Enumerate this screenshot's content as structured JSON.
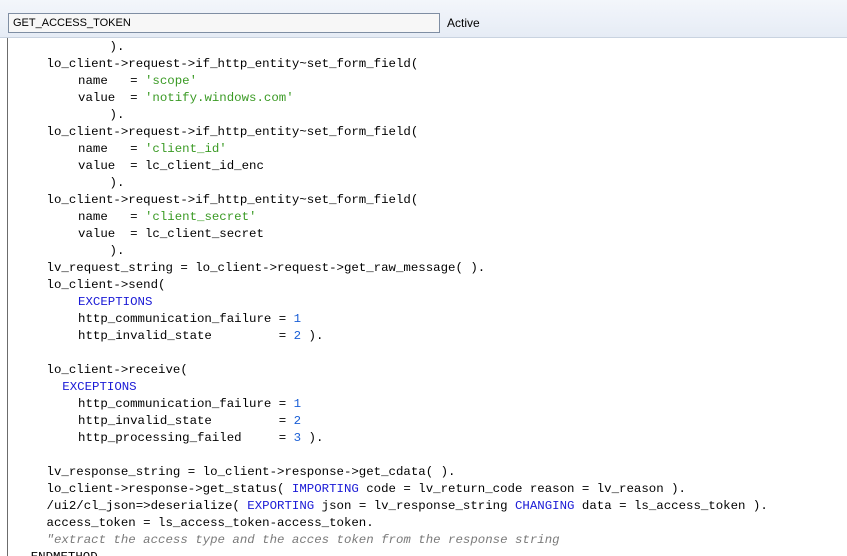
{
  "header": {
    "method_name": "GET_ACCESS_TOKEN",
    "status": "Active"
  },
  "editor": {
    "lines": [
      {
        "indent": 12,
        "tokens": [
          {
            "t": "default",
            "v": ")."
          }
        ]
      },
      {
        "indent": 4,
        "tokens": [
          {
            "t": "default",
            "v": "lo_client->request->if_http_entity~set_form_field("
          }
        ]
      },
      {
        "indent": 8,
        "tokens": [
          {
            "t": "default",
            "v": "name   = "
          },
          {
            "t": "str",
            "v": "'scope'"
          }
        ]
      },
      {
        "indent": 8,
        "tokens": [
          {
            "t": "default",
            "v": "value  = "
          },
          {
            "t": "str",
            "v": "'notify.windows.com'"
          }
        ]
      },
      {
        "indent": 12,
        "tokens": [
          {
            "t": "default",
            "v": ")."
          }
        ]
      },
      {
        "indent": 4,
        "tokens": [
          {
            "t": "default",
            "v": "lo_client->request->if_http_entity~set_form_field("
          }
        ]
      },
      {
        "indent": 8,
        "tokens": [
          {
            "t": "default",
            "v": "name   = "
          },
          {
            "t": "str",
            "v": "'client_id'"
          }
        ]
      },
      {
        "indent": 8,
        "tokens": [
          {
            "t": "default",
            "v": "value  = lc_client_id_enc"
          }
        ]
      },
      {
        "indent": 12,
        "tokens": [
          {
            "t": "default",
            "v": ")."
          }
        ]
      },
      {
        "indent": 4,
        "tokens": [
          {
            "t": "default",
            "v": "lo_client->request->if_http_entity~set_form_field("
          }
        ]
      },
      {
        "indent": 8,
        "tokens": [
          {
            "t": "default",
            "v": "name   = "
          },
          {
            "t": "str",
            "v": "'client_secret'"
          }
        ]
      },
      {
        "indent": 8,
        "tokens": [
          {
            "t": "default",
            "v": "value  = lc_client_secret"
          }
        ]
      },
      {
        "indent": 12,
        "tokens": [
          {
            "t": "default",
            "v": ")."
          }
        ]
      },
      {
        "indent": 4,
        "tokens": [
          {
            "t": "default",
            "v": "lv_request_string = lo_client->request->get_raw_message( )."
          }
        ]
      },
      {
        "indent": 4,
        "tokens": [
          {
            "t": "default",
            "v": "lo_client->send("
          }
        ]
      },
      {
        "indent": 8,
        "tokens": [
          {
            "t": "kw",
            "v": "EXCEPTIONS"
          }
        ]
      },
      {
        "indent": 8,
        "tokens": [
          {
            "t": "default",
            "v": "http_communication_failure = "
          },
          {
            "t": "num",
            "v": "1"
          }
        ]
      },
      {
        "indent": 8,
        "tokens": [
          {
            "t": "default",
            "v": "http_invalid_state         = "
          },
          {
            "t": "num",
            "v": "2"
          },
          {
            "t": "default",
            "v": " )."
          }
        ]
      },
      {
        "indent": 0,
        "tokens": []
      },
      {
        "indent": 4,
        "tokens": [
          {
            "t": "default",
            "v": "lo_client->receive("
          }
        ]
      },
      {
        "indent": 6,
        "tokens": [
          {
            "t": "kw",
            "v": "EXCEPTIONS"
          }
        ]
      },
      {
        "indent": 8,
        "tokens": [
          {
            "t": "default",
            "v": "http_communication_failure = "
          },
          {
            "t": "num",
            "v": "1"
          }
        ]
      },
      {
        "indent": 8,
        "tokens": [
          {
            "t": "default",
            "v": "http_invalid_state         = "
          },
          {
            "t": "num",
            "v": "2"
          }
        ]
      },
      {
        "indent": 8,
        "tokens": [
          {
            "t": "default",
            "v": "http_processing_failed     = "
          },
          {
            "t": "num",
            "v": "3"
          },
          {
            "t": "default",
            "v": " )."
          }
        ]
      },
      {
        "indent": 0,
        "tokens": []
      },
      {
        "indent": 4,
        "tokens": [
          {
            "t": "default",
            "v": "lv_response_string = lo_client->response->get_cdata( )."
          }
        ]
      },
      {
        "indent": 4,
        "tokens": [
          {
            "t": "default",
            "v": "lo_client->response->get_status( "
          },
          {
            "t": "kw",
            "v": "IMPORTING"
          },
          {
            "t": "default",
            "v": " code = lv_return_code reason = lv_reason )."
          }
        ]
      },
      {
        "indent": 4,
        "tokens": [
          {
            "t": "default",
            "v": "/ui2/cl_json=>deserialize( "
          },
          {
            "t": "kw",
            "v": "EXPORTING"
          },
          {
            "t": "default",
            "v": " json = lv_response_string "
          },
          {
            "t": "kw",
            "v": "CHANGING"
          },
          {
            "t": "default",
            "v": " data = ls_access_token )."
          }
        ]
      },
      {
        "indent": 4,
        "tokens": [
          {
            "t": "default",
            "v": "access_token = ls_access_token-access_token."
          }
        ]
      },
      {
        "indent": 4,
        "tokens": [
          {
            "t": "comment",
            "v": "\"extract the access type and the acces token from the response string"
          }
        ]
      },
      {
        "indent": 2,
        "tokens": [
          {
            "t": "default",
            "v": "ENDMETHOD."
          }
        ]
      }
    ]
  }
}
